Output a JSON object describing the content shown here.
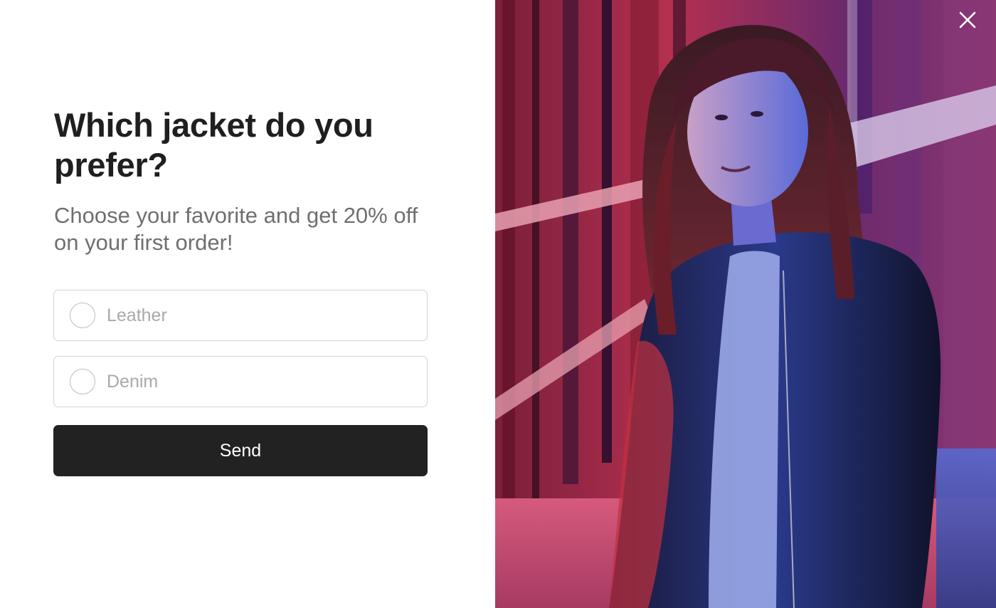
{
  "form": {
    "title": "Which jacket do you prefer?",
    "subtitle": "Choose your favorite and get 20% off on your first order!",
    "options": [
      {
        "label": "Leather",
        "selected": false
      },
      {
        "label": "Denim",
        "selected": false
      }
    ],
    "submit_label": "Send"
  },
  "close_icon": "close-icon",
  "colors": {
    "title": "#1f1f1f",
    "subtitle": "#6f6f6f",
    "button_bg": "#222222",
    "button_text": "#ffffff",
    "option_border": "#d4d4d4",
    "option_text": "#a9a9a9"
  }
}
